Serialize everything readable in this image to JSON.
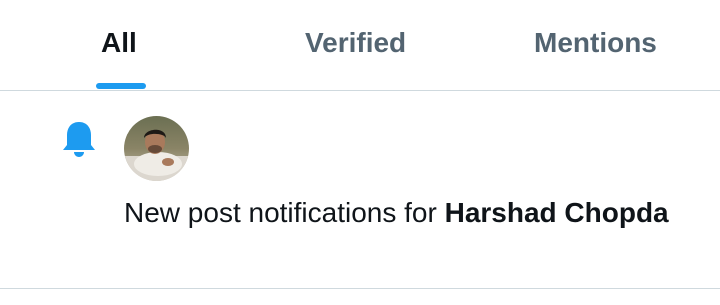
{
  "tabs": [
    {
      "label": "All",
      "active": true
    },
    {
      "label": "Verified",
      "active": false
    },
    {
      "label": "Mentions",
      "active": false
    }
  ],
  "colors": {
    "accent": "#1d9bf0",
    "text_primary": "#0f1419",
    "text_secondary": "#536471",
    "divider": "#cfd9de"
  },
  "notification": {
    "icon": "bell-icon",
    "avatar": "user-avatar",
    "text_prefix": "New post notifications for ",
    "user_name": "Harshad Chopda"
  }
}
